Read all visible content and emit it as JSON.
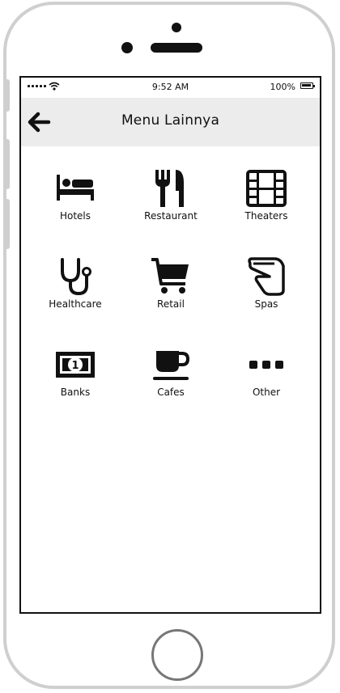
{
  "status_bar": {
    "time": "9:52 AM",
    "battery": "100%"
  },
  "nav": {
    "title": "Menu Lainnya"
  },
  "menu": [
    {
      "label": "Hotels",
      "icon": "bed-icon"
    },
    {
      "label": "Restaurant",
      "icon": "fork-knife-icon"
    },
    {
      "label": "Theaters",
      "icon": "film-icon"
    },
    {
      "label": "Healthcare",
      "icon": "stethoscope-icon"
    },
    {
      "label": "Retail",
      "icon": "shopping-cart-icon"
    },
    {
      "label": "Spas",
      "icon": "hand-icon"
    },
    {
      "label": "Banks",
      "icon": "money-icon"
    },
    {
      "label": "Cafes",
      "icon": "coffee-cup-icon"
    },
    {
      "label": "Other",
      "icon": "ellipsis-icon"
    }
  ]
}
